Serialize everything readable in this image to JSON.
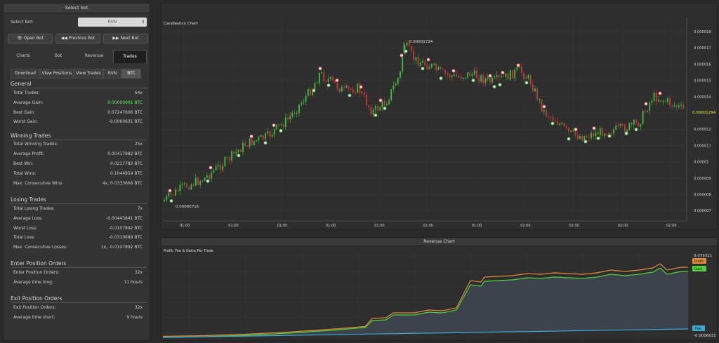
{
  "left_panel": {
    "title": "Select bot",
    "select_label": "Select Bot:",
    "select_value": "RVN",
    "buttons": [
      "Open Bot",
      "Previous Bot",
      "Next Bot"
    ],
    "tabs": [
      "Charts",
      "Bot",
      "Revenue",
      "Trades"
    ],
    "active_tab": "Trades",
    "subtabs": [
      "Download",
      "View Positions",
      "View Trades",
      "RVN",
      "BTC"
    ],
    "active_subtab": "BTC",
    "general": {
      "heading": "General",
      "rows": [
        {
          "label": "Total Trades:",
          "value": "64x"
        },
        {
          "label": "Average Gain:",
          "value": "0.00000001 BTC"
        },
        {
          "label": "Best Gain:",
          "value": "0.07247606 BTC"
        },
        {
          "label": "Worst Gain:",
          "value": "-0.0060631 BTC"
        }
      ]
    },
    "winning": {
      "heading": "Winning Trades",
      "rows": [
        {
          "label": "Total Winning Trades:",
          "value": "25x"
        },
        {
          "label": "Average Profit:",
          "value": "0.00417982 BTC"
        },
        {
          "label": "Best Win:",
          "value": "0.0217782 BTC"
        },
        {
          "label": "Total Wins:",
          "value": "0.1044954 BTC"
        },
        {
          "label": "Max. Consecutive Wins:",
          "value": "4x, 0.0333666 BTC"
        }
      ]
    },
    "losing": {
      "heading": "Losing Trades",
      "rows": [
        {
          "label": "Total Losing Trades:",
          "value": "7x"
        },
        {
          "label": "Average Loss:",
          "value": "-0.00443841 BTC"
        },
        {
          "label": "Worst Loss:",
          "value": "-0.0107892 BTC"
        },
        {
          "label": "Total Loss:",
          "value": "-0.0310689 BTC"
        },
        {
          "label": "Max. Consecutive Losses:",
          "value": "1x, -0.0107892 BTC"
        }
      ]
    },
    "enter": {
      "heading": "Enter Position Orders",
      "rows": [
        {
          "label": "Enter Position Orders:",
          "value": "32x"
        },
        {
          "label": "Average time long:",
          "value": "11 hours"
        }
      ]
    },
    "exit": {
      "heading": "Exit Position Orders",
      "rows": [
        {
          "label": "Exit Position Orders:",
          "value": "32x"
        },
        {
          "label": "Average time short:",
          "value": "9 hours"
        }
      ]
    }
  },
  "candlestick": {
    "title": "Candlestick Chart",
    "high_label": "0.00001724",
    "low_label": "0.00000716",
    "current_label": "0.00001294",
    "y_ticks": [
      "0.000018",
      "0.000017",
      "0.000016",
      "0.000015",
      "0.000014",
      "0.000013",
      "0.000012",
      "0.000011",
      "0.00001",
      "0.000009",
      "0.000008",
      "0.000007"
    ],
    "x_ticks": [
      "01:00",
      "01:00",
      "01:00",
      "01:00",
      "01:00",
      "01:00",
      "01:00",
      "02:00",
      "02:00",
      "02:00",
      "02:00"
    ]
  },
  "revenue": {
    "panel_title": "Revenue Chart",
    "subtitle": "Profit, Fee & Gains Per Trade",
    "top_label": "0.079321",
    "bottom_label": "-0.0006631",
    "legend": [
      "Profit",
      "Gain",
      "Fee"
    ],
    "colors": {
      "profit": "#e08a3c",
      "gain": "#4fd23a",
      "fee": "#3fa9d6"
    }
  },
  "colors": {
    "up": "#3fbf3f",
    "down": "#c83a3a",
    "bg": "#2e2e2e"
  }
}
